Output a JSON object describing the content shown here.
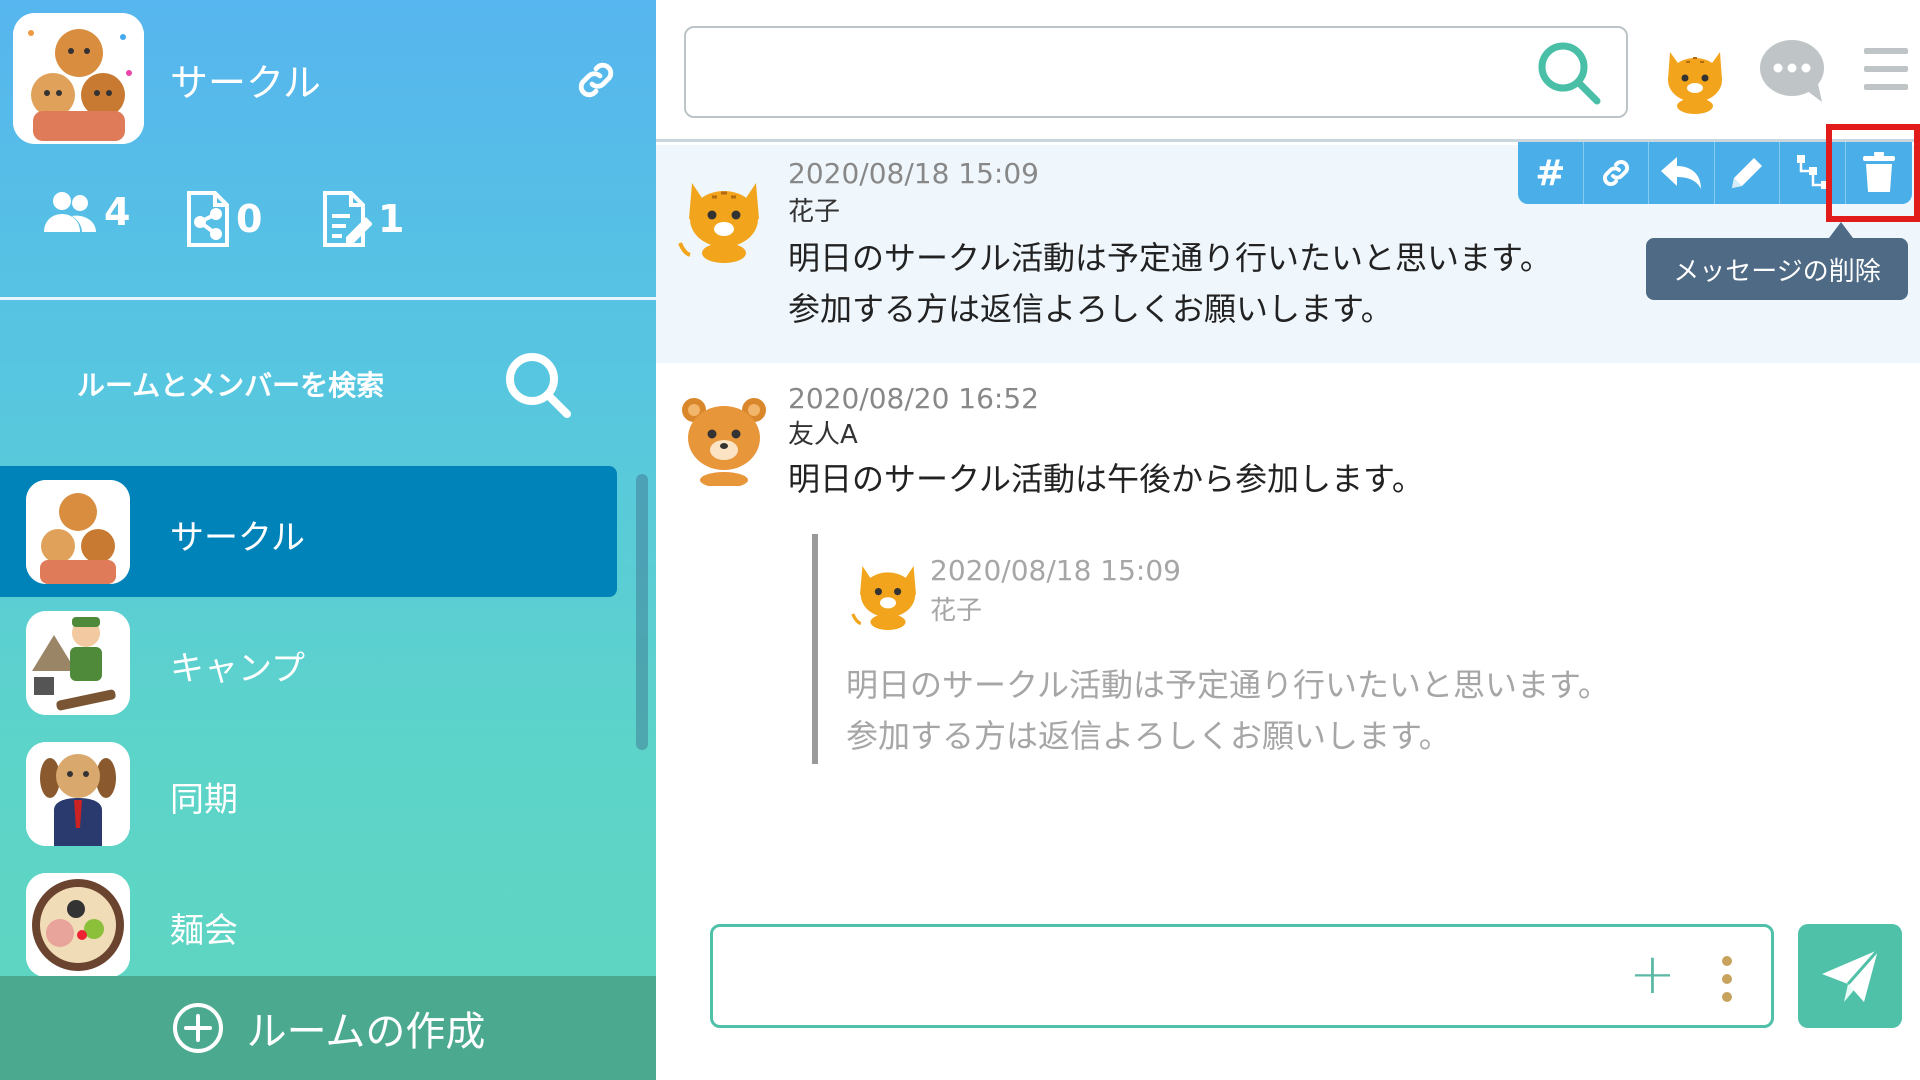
{
  "sidebar": {
    "room_title": "サークル",
    "stats": {
      "members": "4",
      "files": "0",
      "notes": "1"
    },
    "search_label": "ルームとメンバーを検索",
    "rooms": [
      {
        "name": "サークル",
        "active": true
      },
      {
        "name": "キャンプ",
        "active": false
      },
      {
        "name": "同期",
        "active": false
      },
      {
        "name": "麺会",
        "active": false
      }
    ],
    "create_room_label": "ルームの作成"
  },
  "topbar": {
    "search_value": "",
    "search_placeholder": ""
  },
  "messages": [
    {
      "time": "2020/08/18 15:09",
      "author": "花子",
      "lines": [
        "明日のサークル活動は予定通り行いたいと思います。",
        "参加する方は返信よろしくお願いします。"
      ]
    },
    {
      "time": "2020/08/20 16:52",
      "author": "友人A",
      "lines": [
        "明日のサークル活動は午後から参加します。"
      ],
      "quote": {
        "time": "2020/08/18 15:09",
        "author": "花子",
        "lines": [
          "明日のサークル活動は予定通り行いたいと思います。",
          "参加する方は返信よろしくお願いします。"
        ]
      }
    }
  ],
  "action_bar": {
    "buttons": [
      "hash-icon",
      "link-icon",
      "reply-icon",
      "edit-icon",
      "thread-icon",
      "trash-icon"
    ],
    "hash_label": "#",
    "tooltip": "メッセージの削除"
  },
  "composer": {
    "value": "",
    "placeholder": ""
  },
  "colors": {
    "sidebar_top": "#56b5ee",
    "sidebar_bottom": "#5ed6bf",
    "active_room": "#0083b8",
    "create_room_bg": "#4aa98f",
    "action_bar": "#4aaee8",
    "highlight_box": "#e21b1b",
    "tooltip_bg": "#4e6a85",
    "accent_green": "#4ec1a8"
  }
}
